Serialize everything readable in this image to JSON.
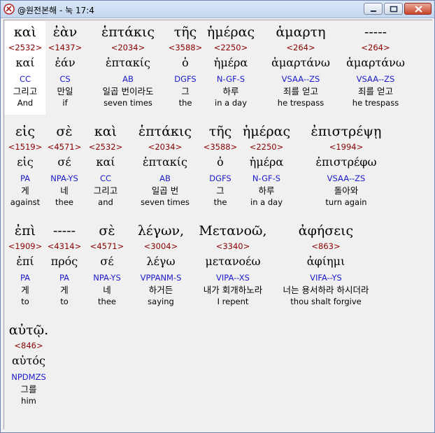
{
  "window": {
    "title": "@원전본해 - 눅 17:4"
  },
  "verse_rows": [
    {
      "words": [
        {
          "greek": "καὶ",
          "number": "<2532>",
          "lemma": "καί",
          "parse": "CC",
          "korean": "그리고",
          "english": "And"
        },
        {
          "greek": "ἐὰν",
          "number": "<1437>",
          "lemma": "ἐάν",
          "parse": "CS",
          "korean": "만일",
          "english": "if"
        },
        {
          "greek": "ἑπτάκις",
          "number": "<2034>",
          "lemma": "ἑπτακίς",
          "parse": "AB",
          "korean": "일곱 번이라도",
          "english": "seven times"
        },
        {
          "greek": "τῆς",
          "number": "<3588>",
          "lemma": "ὁ",
          "parse": "DGFS",
          "korean": "그",
          "english": "the"
        },
        {
          "greek": "ἡμέρας",
          "number": "<2250>",
          "lemma": "ἡμέρα",
          "parse": "N-GF-S",
          "korean": "하루",
          "english": "in a day"
        },
        {
          "greek": "ἁμαρτη",
          "number": "<264>",
          "lemma": "ἁμαρτάνω",
          "parse": "VSAA--ZS",
          "korean": "죄를 얻고",
          "english": "he trespass"
        },
        {
          "greek": "-----",
          "number": "<264>",
          "lemma": "ἁμαρτάνω",
          "parse": "VSAA--ZS",
          "korean": "죄를 얻고",
          "english": "he trespass"
        }
      ]
    },
    {
      "words": [
        {
          "greek": "εἰς",
          "number": "<1519>",
          "lemma": "εἰς",
          "parse": "PA",
          "korean": "게",
          "english": "against"
        },
        {
          "greek": "σὲ",
          "number": "<4571>",
          "lemma": "σέ",
          "parse": "NPA-YS",
          "korean": "네",
          "english": "thee"
        },
        {
          "greek": "καὶ",
          "number": "<2532>",
          "lemma": "καί",
          "parse": "CC",
          "korean": "그리고",
          "english": "and"
        },
        {
          "greek": "ἑπτάκις",
          "number": "<2034>",
          "lemma": "ἑπτακίς",
          "parse": "AB",
          "korean": "일곱 번",
          "english": "seven times"
        },
        {
          "greek": "τῆς",
          "number": "<3588>",
          "lemma": "ὁ",
          "parse": "DGFS",
          "korean": "그",
          "english": "the"
        },
        {
          "greek": "ἡμέρας",
          "number": "<2250>",
          "lemma": "ἡμέρα",
          "parse": "N-GF-S",
          "korean": "하루",
          "english": "in a day"
        },
        {
          "greek": "ἐπιστρέψῃ",
          "number": "<1994>",
          "lemma": "ἐπιστρέφω",
          "parse": "VSAA--ZS",
          "korean": "돌아와",
          "english": "turn again"
        }
      ]
    },
    {
      "words": [
        {
          "greek": "ἐπὶ",
          "number": "<1909>",
          "lemma": "ἐπί",
          "parse": "PA",
          "korean": "게",
          "english": "to"
        },
        {
          "greek": "-----",
          "number": "<4314>",
          "lemma": "πρός",
          "parse": "PA",
          "korean": "게",
          "english": "to"
        },
        {
          "greek": "σὲ",
          "number": "<4571>",
          "lemma": "σέ",
          "parse": "NPA-YS",
          "korean": "네",
          "english": "thee"
        },
        {
          "greek": "λέγων,",
          "number": "<3004>",
          "lemma": "λέγω",
          "parse": "VPPANM-S",
          "korean": "하거든",
          "english": "saying"
        },
        {
          "greek": "Μετανοῶ,",
          "number": "<3340>",
          "lemma": "μετανοέω",
          "parse": "VIPA--XS",
          "korean": "내가 회개하노라",
          "english": "I repent"
        },
        {
          "greek": "ἀφήσεις",
          "number": "<863>",
          "lemma": "ἀφίημι",
          "parse": "VIFA--YS",
          "korean": "너는 용서하라 하시더라",
          "english": "thou shalt forgive"
        }
      ]
    },
    {
      "words": [
        {
          "greek": "αὐτῷ.",
          "number": "<846>",
          "lemma": "αὐτός",
          "parse": "NPDMZS",
          "korean": "그를",
          "english": "him"
        }
      ]
    }
  ]
}
